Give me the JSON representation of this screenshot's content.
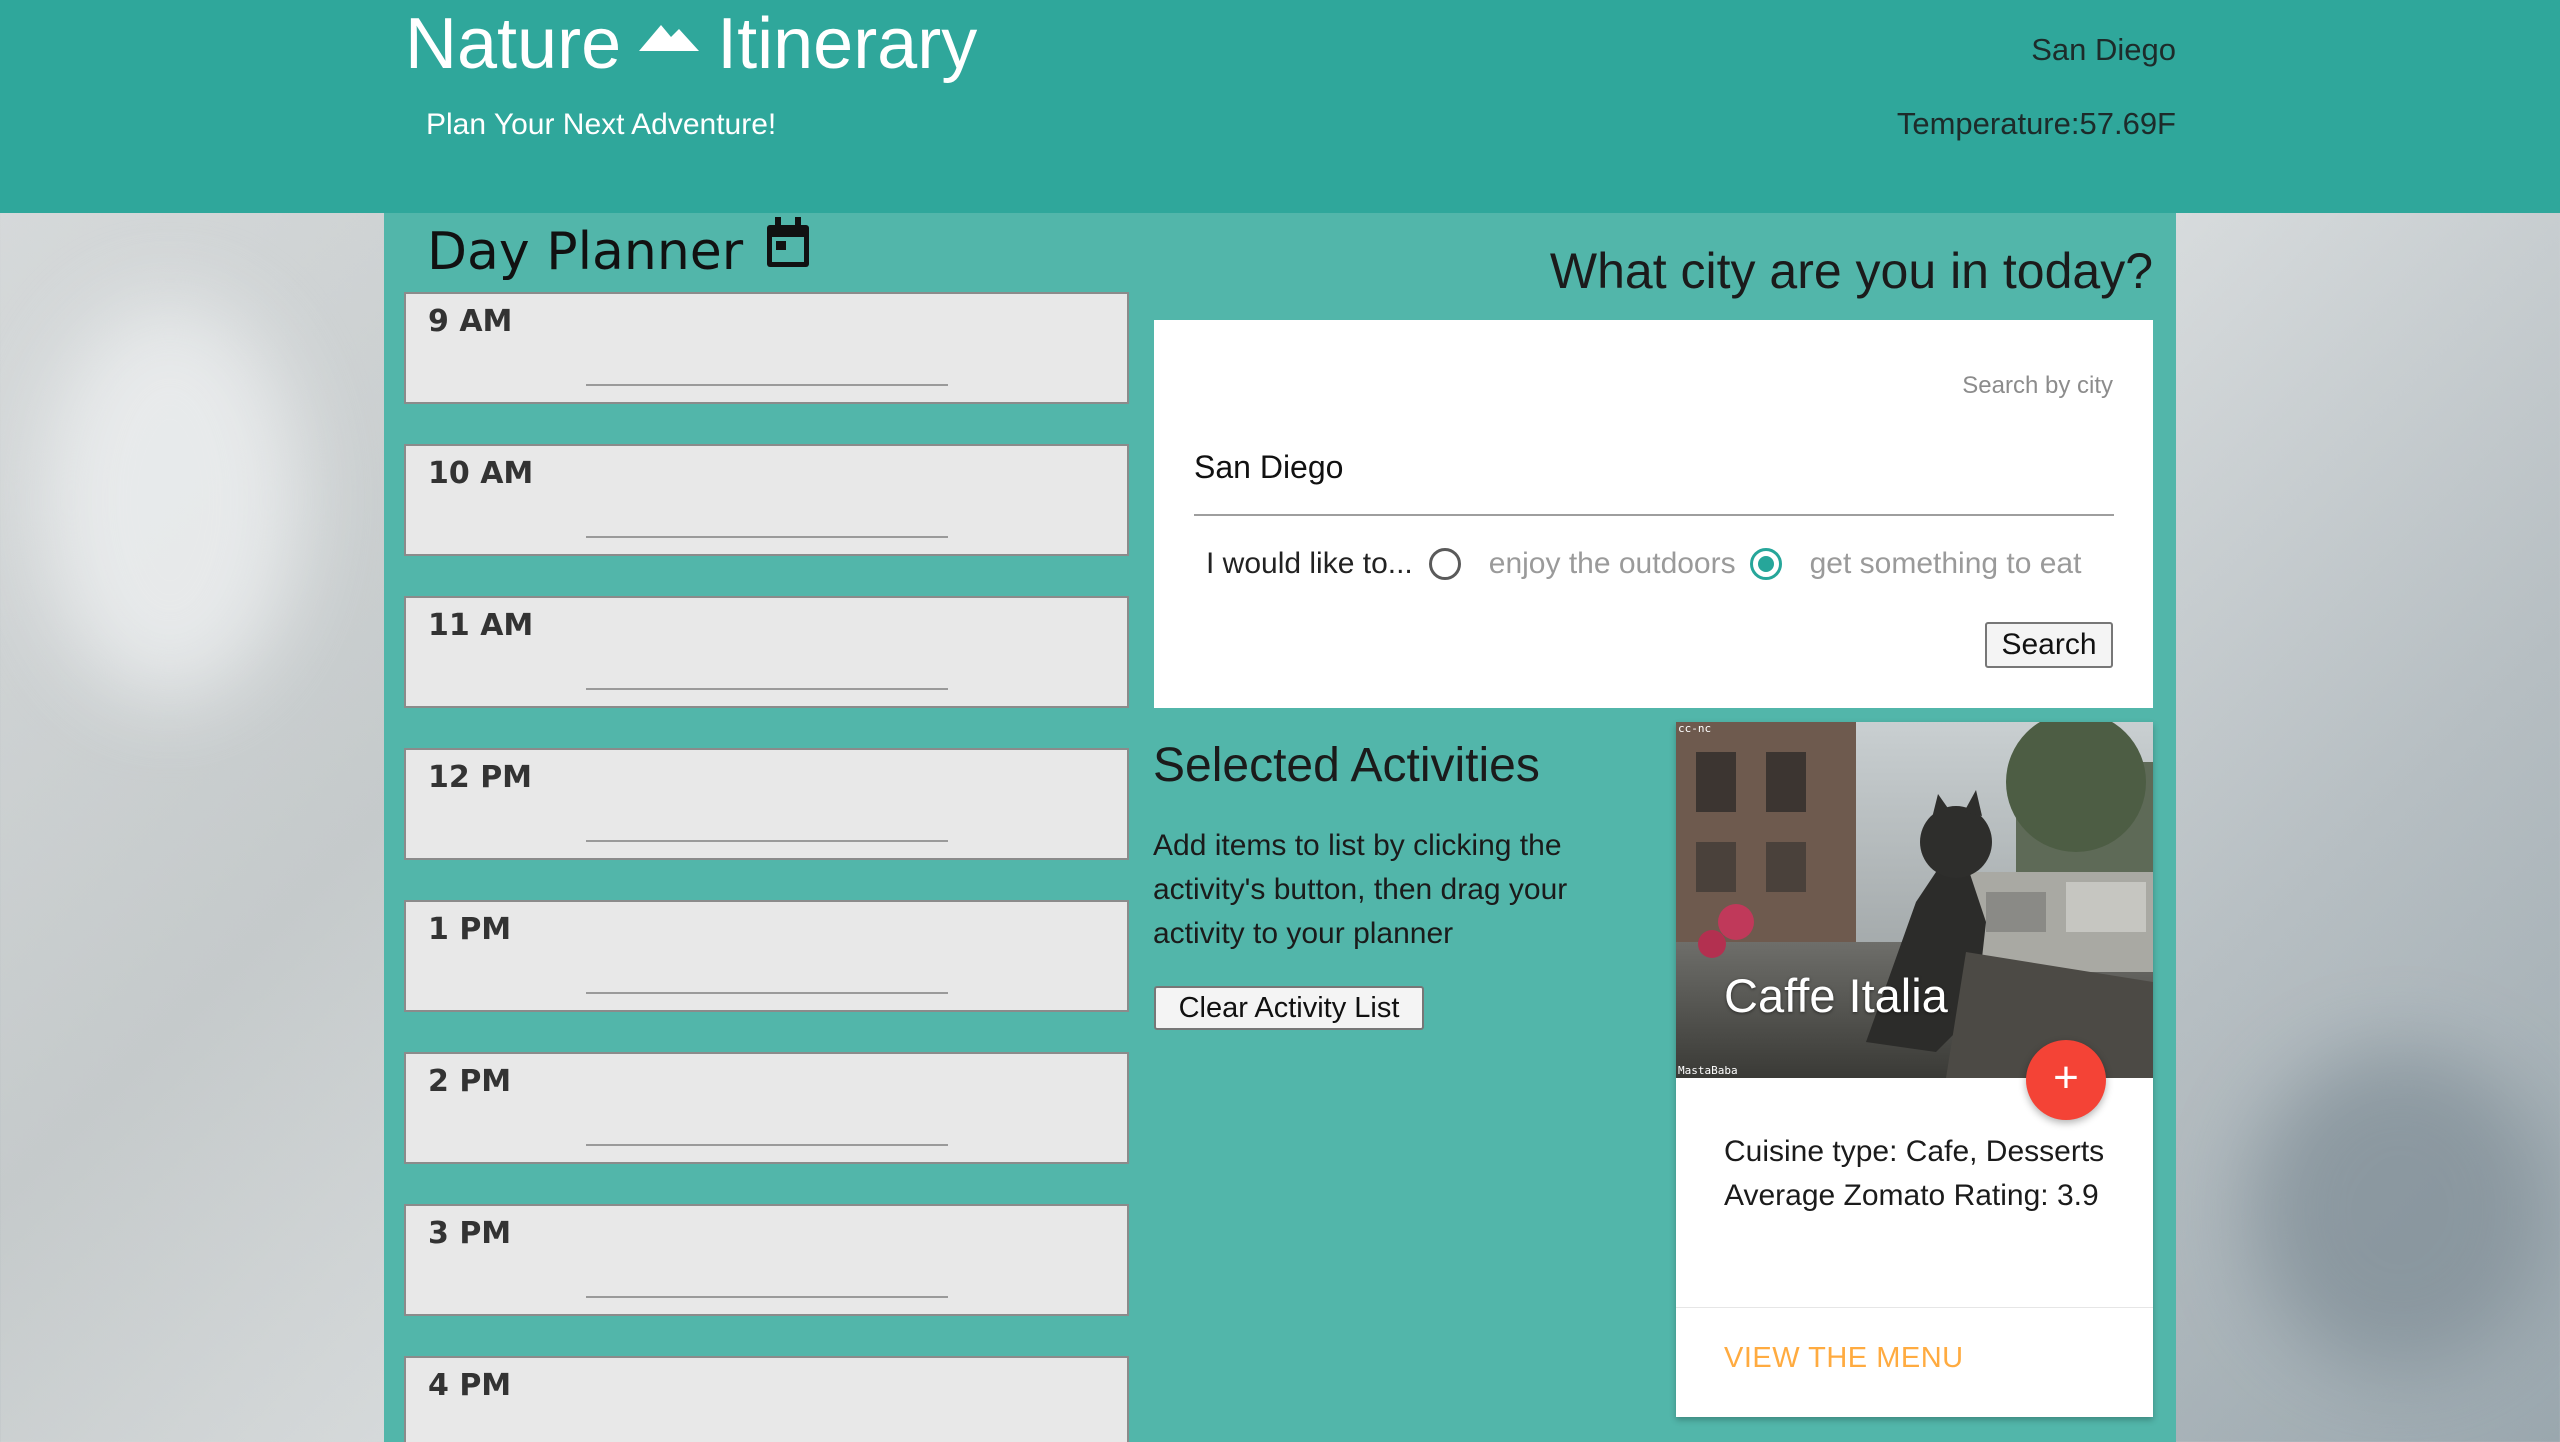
{
  "header": {
    "brand_left": "Nature",
    "brand_icon": "mountain-icon",
    "brand_right": "Itinerary",
    "tagline": "Plan Your Next Adventure!",
    "city": "San Diego",
    "temperature": "Temperature:57.69F"
  },
  "planner": {
    "title": "Day Planner",
    "title_icon": "calendar-icon",
    "slots": [
      {
        "label": "9 AM"
      },
      {
        "label": "10 AM"
      },
      {
        "label": "11 AM"
      },
      {
        "label": "12 PM"
      },
      {
        "label": "1 PM"
      },
      {
        "label": "2 PM"
      },
      {
        "label": "3 PM"
      },
      {
        "label": "4 PM"
      }
    ]
  },
  "search": {
    "question": "What city are you in today?",
    "placeholder": "Search by city",
    "value": "San Diego",
    "prefs_lead": "I would like to...",
    "options": [
      {
        "label": "enjoy the outdoors",
        "checked": false
      },
      {
        "label": "get something to eat",
        "checked": true
      }
    ],
    "button": "Search"
  },
  "selected": {
    "title": "Selected Activities",
    "description": "Add items to list by clicking the activity's button, then drag your activity to your planner",
    "clear_button": "Clear Activity List"
  },
  "result_card": {
    "title": "Caffe Italia",
    "image_credit_top": "cc-nc",
    "image_credit_bottom": "MastaBaba",
    "add_button": "+",
    "cuisine": "Cuisine type: Cafe, Desserts",
    "rating": "Average Zomato Rating: 3.9",
    "link": "VIEW THE MENU"
  },
  "colors": {
    "header_bg": "#2fa79b",
    "panel_bg": "#52b6aa",
    "accent_radio": "#26a69a",
    "fab": "#f44336",
    "link": "#ffab40"
  }
}
